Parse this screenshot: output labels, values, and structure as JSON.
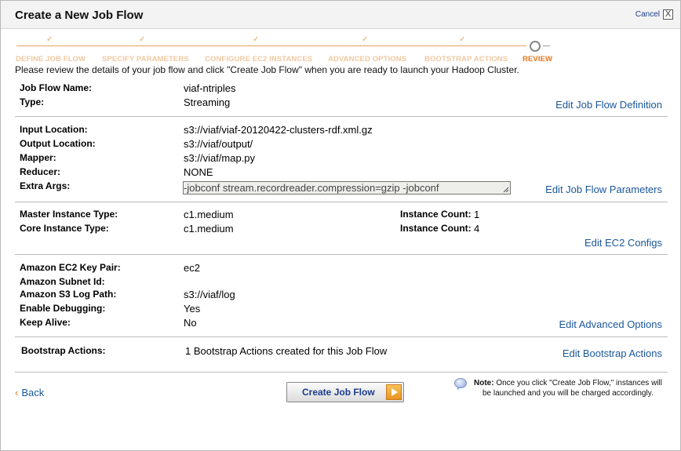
{
  "dialog": {
    "title": "Create a New Job Flow",
    "cancel_label": "Cancel",
    "close_glyph": "X"
  },
  "wizard": {
    "tick_glyph": "✓",
    "steps": [
      {
        "label": "DEFINE JOB FLOW",
        "state": "done"
      },
      {
        "label": "SPECIFY PARAMETERS",
        "state": "done"
      },
      {
        "label": "CONFIGURE EC2 INSTANCES",
        "state": "done"
      },
      {
        "label": "ADVANCED OPTIONS",
        "state": "done"
      },
      {
        "label": "BOOTSTRAP ACTIONS",
        "state": "done"
      },
      {
        "label": "REVIEW",
        "state": "current"
      }
    ]
  },
  "intro_text": "Please review the details of your job flow and click \"Create Job Flow\" when you are ready to launch your Hadoop Cluster.",
  "sections": {
    "definition": {
      "job_flow_name_label": "Job Flow Name:",
      "job_flow_name_value": "viaf-ntriples",
      "type_label": "Type:",
      "type_value": "Streaming",
      "edit_label": "Edit Job Flow Definition"
    },
    "parameters": {
      "input_label": "Input Location:",
      "input_value": "s3://viaf/viaf-20120422-clusters-rdf.xml.gz",
      "output_label": "Output Location:",
      "output_value": "s3://viaf/output/",
      "mapper_label": "Mapper:",
      "mapper_value": "s3://viaf/map.py",
      "reducer_label": "Reducer:",
      "reducer_value": "NONE",
      "extra_args_label": "Extra Args:",
      "extra_args_value": "-jobconf stream.recordreader.compression=gzip -jobconf",
      "edit_label": "Edit Job Flow Parameters"
    },
    "ec2": {
      "master_type_label": "Master Instance Type:",
      "master_type_value": "c1.medium",
      "core_type_label": "Core Instance Type:",
      "core_type_value": "c1.medium",
      "master_count_label": "Instance Count:",
      "master_count_value": "1",
      "core_count_label": "Instance Count:",
      "core_count_value": "4",
      "edit_label": "Edit EC2 Configs"
    },
    "advanced": {
      "key_pair_label": "Amazon EC2 Key Pair:",
      "key_pair_value": "ec2",
      "subnet_label": "Amazon Subnet Id:",
      "subnet_value": "",
      "log_path_label": "Amazon S3 Log Path:",
      "log_path_value": "s3://viaf/log",
      "debugging_label": "Enable Debugging:",
      "debugging_value": "Yes",
      "keep_alive_label": "Keep Alive:",
      "keep_alive_value": "No",
      "edit_label": "Edit Advanced Options"
    },
    "bootstrap": {
      "label": "Bootstrap Actions:",
      "value": "1 Bootstrap Actions created for this Job Flow",
      "edit_label": "Edit Bootstrap Actions"
    }
  },
  "footer": {
    "back_chevron": "‹",
    "back_label": "Back",
    "create_label": "Create Job Flow",
    "note_label": "Note:",
    "note_line1": "Once you click \"Create Job Flow,\" instances will",
    "note_line2": "be launched and you will be charged accordingly."
  },
  "colors": {
    "accent_orange": "#e8761c",
    "link_blue": "#1a5799"
  },
  "icons": {
    "close": "close-icon",
    "resize": "resize-grip-icon",
    "arrow": "arrow-right-icon",
    "note": "speech-bubble-icon"
  }
}
